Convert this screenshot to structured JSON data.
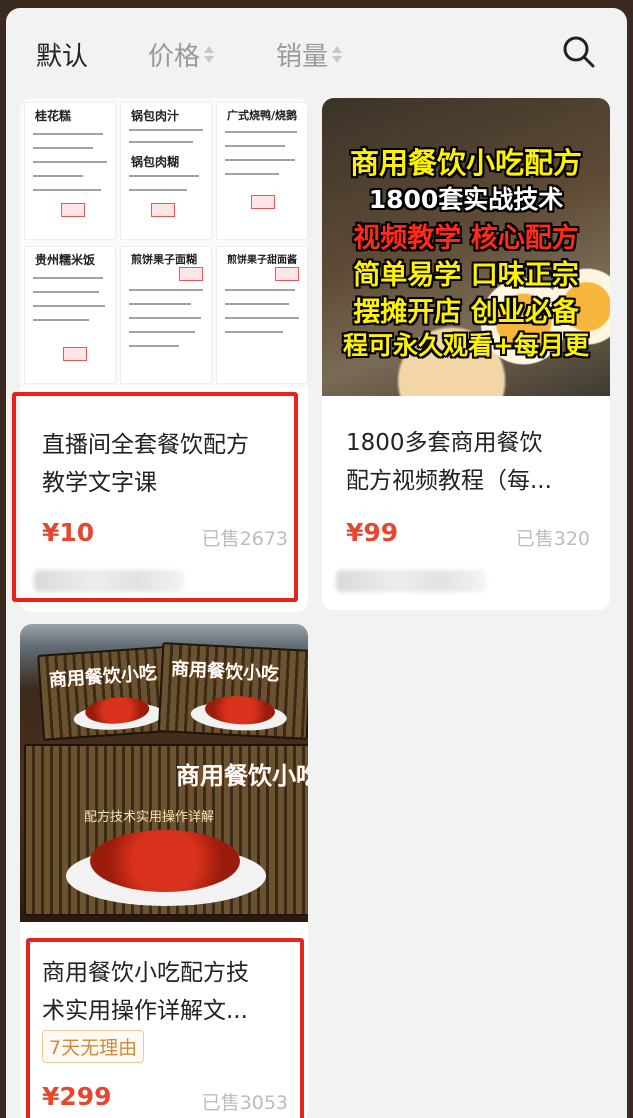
{
  "sort_bar": {
    "default_label": "默认",
    "price_label": "价格",
    "sales_label": "销量",
    "search_icon": "search-icon"
  },
  "products": [
    {
      "title_line1": "直播间全套餐饮配方",
      "title_line2": "教学文字课",
      "price": "¥10",
      "sold": "已售2673",
      "thumbnail_sheets": [
        "桂花糕",
        "锅包肉汁",
        "广式烧鸭/烧鹅",
        "锅包肉糊",
        "贵州糯米饭",
        "煎饼果子面糊",
        "煎饼果子甜面酱"
      ],
      "highlighted": true
    },
    {
      "title_line1": "1800多套商用餐饮",
      "title_line2": "配方视频教程（每...",
      "price": "¥99",
      "sold": "已售320",
      "poster_lines": [
        "商用餐饮小吃配方",
        "1800套实战技术",
        "视频教学 核心配方",
        "简单易学 口味正宗",
        "摆摊开店 创业必备",
        "程可永久观看+每月更"
      ],
      "highlighted": false
    },
    {
      "title_line1": "商用餐饮小吃配方技",
      "title_line2": "术实用操作详解文...",
      "tag": "7天无理由",
      "price": "¥299",
      "sold": "已售3053",
      "book_title": "商用餐饮小吃",
      "book_subtitle": "配方技术实用操作详解",
      "highlighted": true
    }
  ],
  "colors": {
    "price": "#e8472f",
    "highlight_border": "#e8231c",
    "poster_yellow": "#fff200",
    "poster_red": "#ff2a1a",
    "tag_text": "#d4893a"
  }
}
